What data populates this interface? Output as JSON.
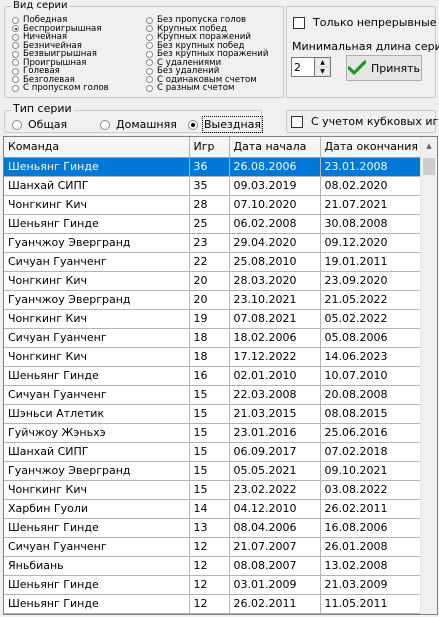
{
  "series_kind": {
    "caption": "Вид серии",
    "left_options": [
      {
        "label": "Победная",
        "selected": false
      },
      {
        "label": "Беспроигрышная",
        "selected": true
      },
      {
        "label": "Ничейная",
        "selected": false
      },
      {
        "label": "Безничейная",
        "selected": false
      },
      {
        "label": "Безвыигрышная",
        "selected": false
      },
      {
        "label": "Проигрышная",
        "selected": false
      },
      {
        "label": "Голевая",
        "selected": false
      },
      {
        "label": "Безголевая",
        "selected": false
      },
      {
        "label": "С пропуском голов",
        "selected": false
      }
    ],
    "right_options": [
      {
        "label": "Без пропуска голов",
        "selected": false
      },
      {
        "label": "Крупных побед",
        "selected": false
      },
      {
        "label": "Крупных поражений",
        "selected": false
      },
      {
        "label": "Без крупных побед",
        "selected": false
      },
      {
        "label": "Без крупных поражений",
        "selected": false
      },
      {
        "label": "С удалениями",
        "selected": false
      },
      {
        "label": "Без удалений",
        "selected": false
      },
      {
        "label": "С одинаковым счетом",
        "selected": false
      },
      {
        "label": "С разным счетом",
        "selected": false
      }
    ]
  },
  "options": {
    "continuous_only_label": "Только непрерывные",
    "continuous_only_checked": false,
    "min_length_label": "Минимальная длина серии",
    "min_length_value": "2",
    "apply_label": "Принять",
    "include_cup_label": "С учетом кубковых игр",
    "include_cup_checked": false
  },
  "series_type": {
    "caption": "Тип серии",
    "options": [
      {
        "label": "Общая",
        "selected": false
      },
      {
        "label": "Домашняя",
        "selected": false
      },
      {
        "label": "Выездная",
        "selected": true
      }
    ]
  },
  "table": {
    "headers": [
      "Команда",
      "Игр",
      "Дата начала",
      "Дата окончания"
    ],
    "selected_row": 0,
    "rows": [
      [
        "Шеньянг Гинде",
        "36",
        "26.08.2006",
        "23.01.2008"
      ],
      [
        "Шанхай СИПГ",
        "35",
        "09.03.2019",
        "08.02.2020"
      ],
      [
        "Чонгкинг Кич",
        "28",
        "07.10.2020",
        "21.07.2021"
      ],
      [
        "Шеньянг Гинде",
        "25",
        "06.02.2008",
        "30.08.2008"
      ],
      [
        "Гуанчжоу Эвергранд",
        "23",
        "29.04.2020",
        "09.12.2020"
      ],
      [
        "Сичуан Гуанченг",
        "22",
        "25.08.2010",
        "19.01.2011"
      ],
      [
        "Чонгкинг Кич",
        "20",
        "28.03.2020",
        "23.09.2020"
      ],
      [
        "Гуанчжоу Эвергранд",
        "20",
        "23.10.2021",
        "21.05.2022"
      ],
      [
        "Чонгкинг Кич",
        "19",
        "07.08.2021",
        "05.02.2022"
      ],
      [
        "Сичуан Гуанченг",
        "18",
        "18.02.2006",
        "05.08.2006"
      ],
      [
        "Чонгкинг Кич",
        "18",
        "17.12.2022",
        "14.06.2023"
      ],
      [
        "Шеньянг Гинде",
        "16",
        "02.01.2010",
        "10.07.2010"
      ],
      [
        "Сичуан Гуанченг",
        "15",
        "22.03.2008",
        "20.08.2008"
      ],
      [
        "Шэньси Атлетик",
        "15",
        "21.03.2015",
        "08.08.2015"
      ],
      [
        "Гуйчжоу Жэньхэ",
        "15",
        "23.01.2016",
        "25.06.2016"
      ],
      [
        "Шанхай СИПГ",
        "15",
        "06.09.2017",
        "07.02.2018"
      ],
      [
        "Гуанчжоу Эвергранд",
        "15",
        "05.05.2021",
        "09.10.2021"
      ],
      [
        "Чонгкинг Кич",
        "15",
        "23.02.2022",
        "03.08.2022"
      ],
      [
        "Харбин Гуоли",
        "14",
        "04.12.2010",
        "26.02.2011"
      ],
      [
        "Шеньянг Гинде",
        "13",
        "08.04.2006",
        "16.08.2006"
      ],
      [
        "Сичуан Гуанченг",
        "12",
        "21.07.2007",
        "26.01.2008"
      ],
      [
        "Яньбиань",
        "12",
        "08.08.2007",
        "13.02.2008"
      ],
      [
        "Шеньянг Гинде",
        "12",
        "03.01.2009",
        "21.03.2009"
      ],
      [
        "Шеньянг Гинде",
        "12",
        "26.02.2011",
        "11.05.2011"
      ]
    ]
  }
}
